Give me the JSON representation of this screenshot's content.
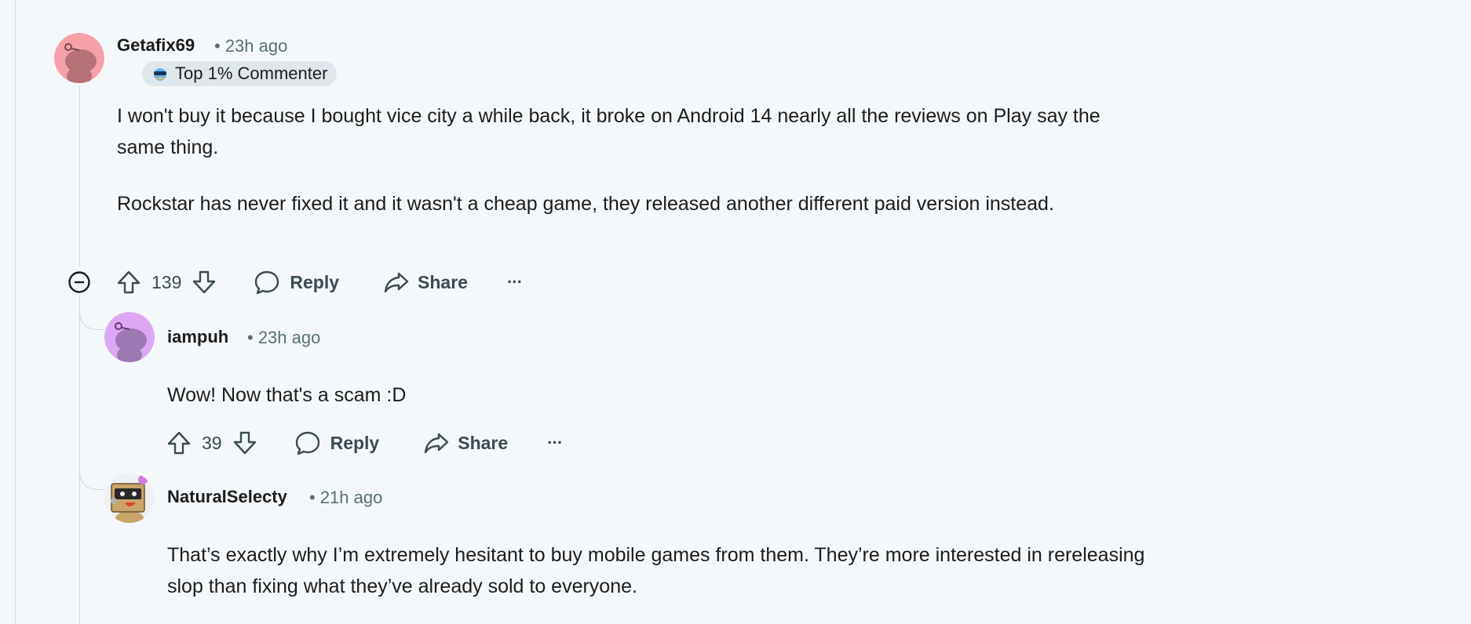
{
  "comments": [
    {
      "username": "Getafix69",
      "time": "• 23h ago",
      "badge": "Top 1% Commenter",
      "paragraphs": [
        "I won't buy it because I bought vice city a while back, it broke on Android 14 nearly all the reviews on Play say the same thing.",
        "Rockstar has never fixed it and it wasn't a cheap game, they released another different paid version instead."
      ],
      "votes": "139",
      "reply_label": "Reply",
      "share_label": "Share",
      "more_label": "···",
      "avatar_color": "#f6a1a8"
    },
    {
      "username": "iampuh",
      "time": "• 23h ago",
      "paragraphs": [
        "Wow! Now that's a scam :D"
      ],
      "votes": "39",
      "reply_label": "Reply",
      "share_label": "Share",
      "more_label": "···",
      "avatar_color": "#dda7f5"
    },
    {
      "username": "NaturalSelecty",
      "time": "• 21h ago",
      "paragraphs": [
        "That’s exactly why I’m extremely hesitant to buy mobile games from them. They’re more interested in rereleasing slop than fixing what they’ve already sold to everyone."
      ]
    }
  ]
}
